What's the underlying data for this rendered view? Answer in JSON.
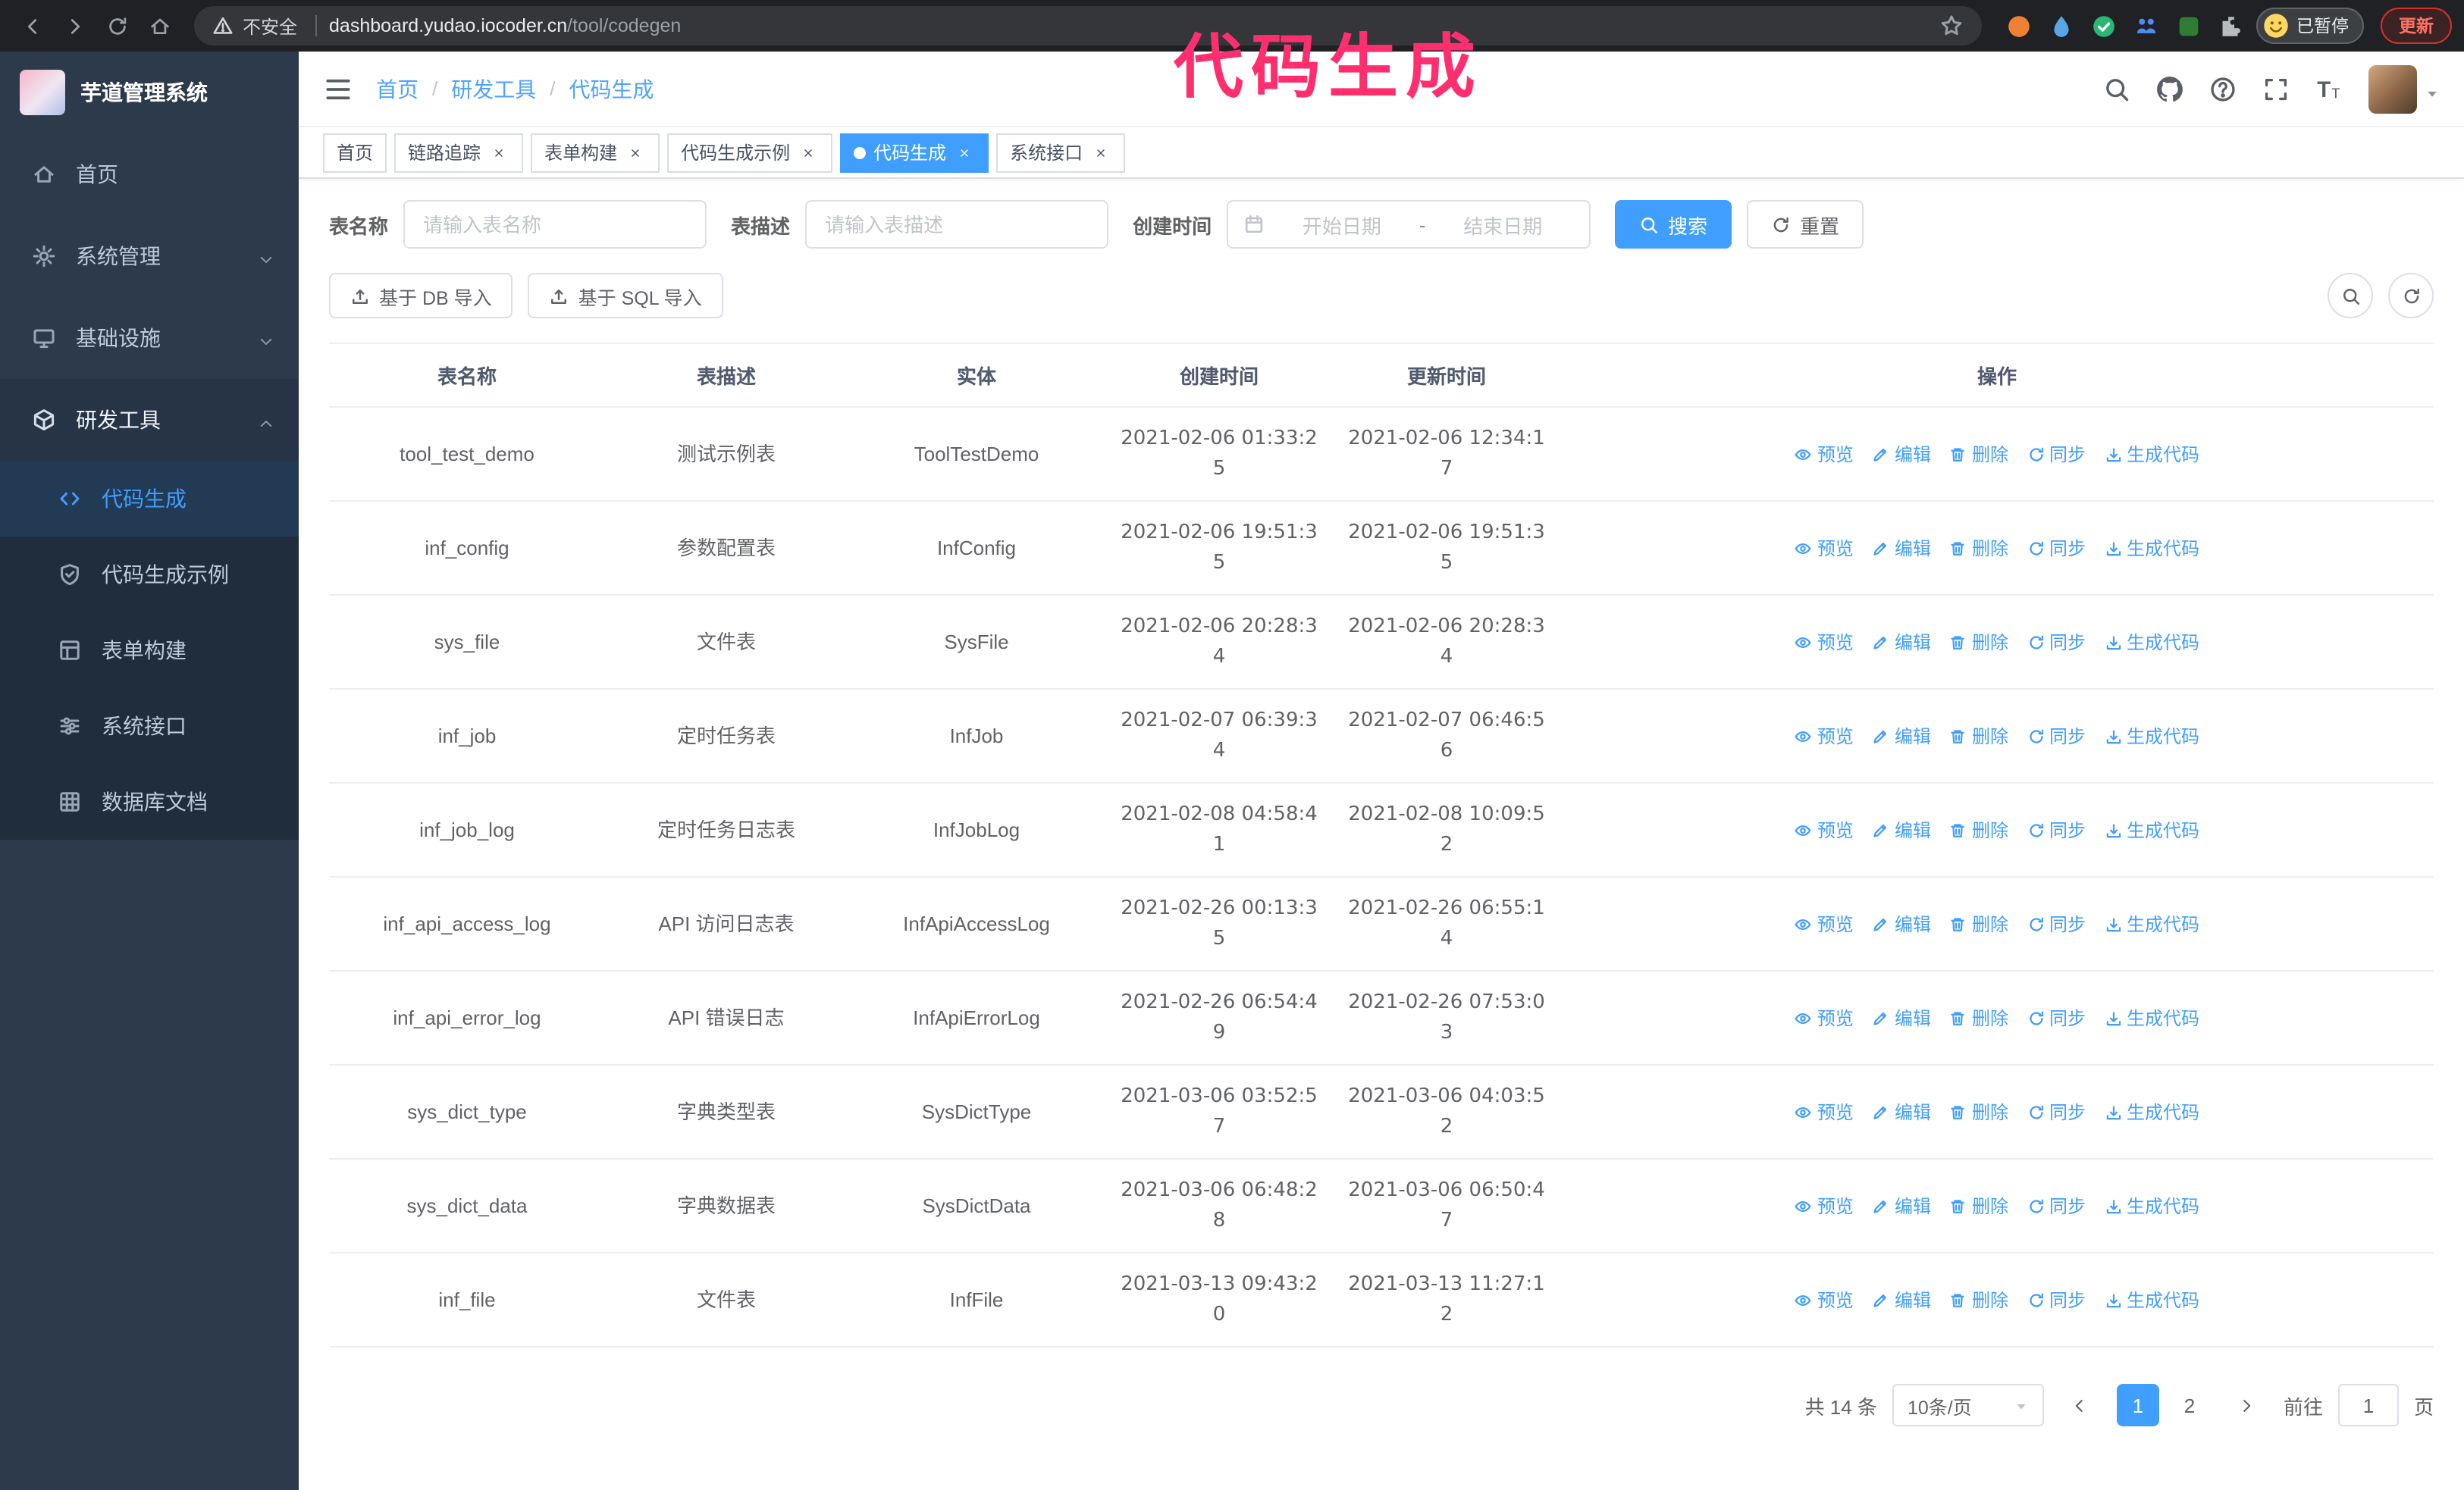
{
  "colors": {
    "accent": "#409EFF",
    "sidebar_bg": "#2d3a4b",
    "submenu_bg": "#1f2d3d",
    "annotation_pink": "#ff2f6f"
  },
  "annotation": {
    "text": "代码生成"
  },
  "browser": {
    "security_warning": "不安全",
    "url_domain": "dashboard.yudao.iocoder.cn",
    "url_path": "/tool/codegen",
    "paused_badge": "已暂停",
    "update_button": "更新",
    "extensions": [
      {
        "name": "extension-icon-orange-circle",
        "shape": "ext-circle",
        "color": "#ee8133"
      },
      {
        "name": "extension-icon-blue-drop",
        "shape": "ext-drop",
        "color": "#58a6e8"
      },
      {
        "name": "extension-icon-green-check",
        "shape": "ext-check",
        "color": "#2bb673"
      },
      {
        "name": "extension-icon-people",
        "shape": "ext-people",
        "color": "#4e8df7"
      },
      {
        "name": "extension-icon-green-square",
        "shape": "ext-square",
        "color": "#2e7d32"
      },
      {
        "name": "extension-icon-puzzle",
        "shape": "ext-puzzle",
        "color": "#b8bcc2"
      }
    ]
  },
  "sidebar": {
    "logo_title": "芋道管理系统",
    "items": [
      {
        "label": "首页",
        "icon": "home-icon"
      },
      {
        "label": "系统管理",
        "icon": "gear-icon",
        "chevron": "down"
      },
      {
        "label": "基础设施",
        "icon": "monitor-icon",
        "chevron": "down"
      },
      {
        "label": "研发工具",
        "icon": "toolbox-icon",
        "chevron": "up",
        "active": true
      }
    ],
    "submenu": [
      {
        "label": "代码生成",
        "icon": "code-icon",
        "active": true
      },
      {
        "label": "代码生成示例",
        "icon": "badge-icon"
      },
      {
        "label": "表单构建",
        "icon": "form-icon"
      },
      {
        "label": "系统接口",
        "icon": "api-icon"
      },
      {
        "label": "数据库文档",
        "icon": "database-icon"
      }
    ]
  },
  "header": {
    "breadcrumb": [
      "首页",
      "研发工具",
      "代码生成"
    ],
    "breadcrumb_separator": "/"
  },
  "tabs": [
    {
      "label": "首页",
      "closable": false,
      "active": false
    },
    {
      "label": "链路追踪",
      "closable": true,
      "active": false
    },
    {
      "label": "表单构建",
      "closable": true,
      "active": false
    },
    {
      "label": "代码生成示例",
      "closable": true,
      "active": false
    },
    {
      "label": "代码生成",
      "closable": true,
      "active": true
    },
    {
      "label": "系统接口",
      "closable": true,
      "active": false
    }
  ],
  "filters": {
    "table_name_label": "表名称",
    "table_name_placeholder": "请输入表名称",
    "table_desc_label": "表描述",
    "table_desc_placeholder": "请输入表描述",
    "create_time_label": "创建时间",
    "date_start_placeholder": "开始日期",
    "date_separator": "-",
    "date_end_placeholder": "结束日期",
    "search_button": "搜索",
    "reset_button": "重置"
  },
  "toolbar": {
    "import_db_button": "基于 DB 导入",
    "import_sql_button": "基于 SQL 导入"
  },
  "table": {
    "columns": [
      "表名称",
      "表描述",
      "实体",
      "创建时间",
      "更新时间",
      "操作"
    ],
    "actions": [
      {
        "label": "预览",
        "icon": "eye-icon",
        "name": "preview-link"
      },
      {
        "label": "编辑",
        "icon": "edit-icon",
        "name": "edit-link"
      },
      {
        "label": "删除",
        "icon": "delete-icon",
        "name": "delete-link"
      },
      {
        "label": "同步",
        "icon": "sync-icon",
        "name": "sync-link"
      },
      {
        "label": "生成代码",
        "icon": "download-icon",
        "name": "generate-code-link"
      }
    ],
    "rows": [
      {
        "name": "tool_test_demo",
        "desc": "测试示例表",
        "entity": "ToolTestDemo",
        "created": "2021-02-06 01:33:25",
        "updated": "2021-02-06 12:34:17"
      },
      {
        "name": "inf_config",
        "desc": "参数配置表",
        "entity": "InfConfig",
        "created": "2021-02-06 19:51:35",
        "updated": "2021-02-06 19:51:35"
      },
      {
        "name": "sys_file",
        "desc": "文件表",
        "entity": "SysFile",
        "created": "2021-02-06 20:28:34",
        "updated": "2021-02-06 20:28:34"
      },
      {
        "name": "inf_job",
        "desc": "定时任务表",
        "entity": "InfJob",
        "created": "2021-02-07 06:39:34",
        "updated": "2021-02-07 06:46:56"
      },
      {
        "name": "inf_job_log",
        "desc": "定时任务日志表",
        "entity": "InfJobLog",
        "created": "2021-02-08 04:58:41",
        "updated": "2021-02-08 10:09:52"
      },
      {
        "name": "inf_api_access_log",
        "desc": "API 访问日志表",
        "entity": "InfApiAccessLog",
        "created": "2021-02-26 00:13:35",
        "updated": "2021-02-26 06:55:14"
      },
      {
        "name": "inf_api_error_log",
        "desc": "API 错误日志",
        "entity": "InfApiErrorLog",
        "created": "2021-02-26 06:54:49",
        "updated": "2021-02-26 07:53:03"
      },
      {
        "name": "sys_dict_type",
        "desc": "字典类型表",
        "entity": "SysDictType",
        "created": "2021-03-06 03:52:57",
        "updated": "2021-03-06 04:03:52"
      },
      {
        "name": "sys_dict_data",
        "desc": "字典数据表",
        "entity": "SysDictData",
        "created": "2021-03-06 06:48:28",
        "updated": "2021-03-06 06:50:47"
      },
      {
        "name": "inf_file",
        "desc": "文件表",
        "entity": "InfFile",
        "created": "2021-03-13 09:43:20",
        "updated": "2021-03-13 11:27:12"
      }
    ]
  },
  "pagination": {
    "total_text": "共 14 条",
    "page_size_value": "10条/页",
    "pages": [
      "1",
      "2"
    ],
    "active_page": "1",
    "goto_label": "前往",
    "goto_value": "1",
    "goto_unit": "页"
  }
}
